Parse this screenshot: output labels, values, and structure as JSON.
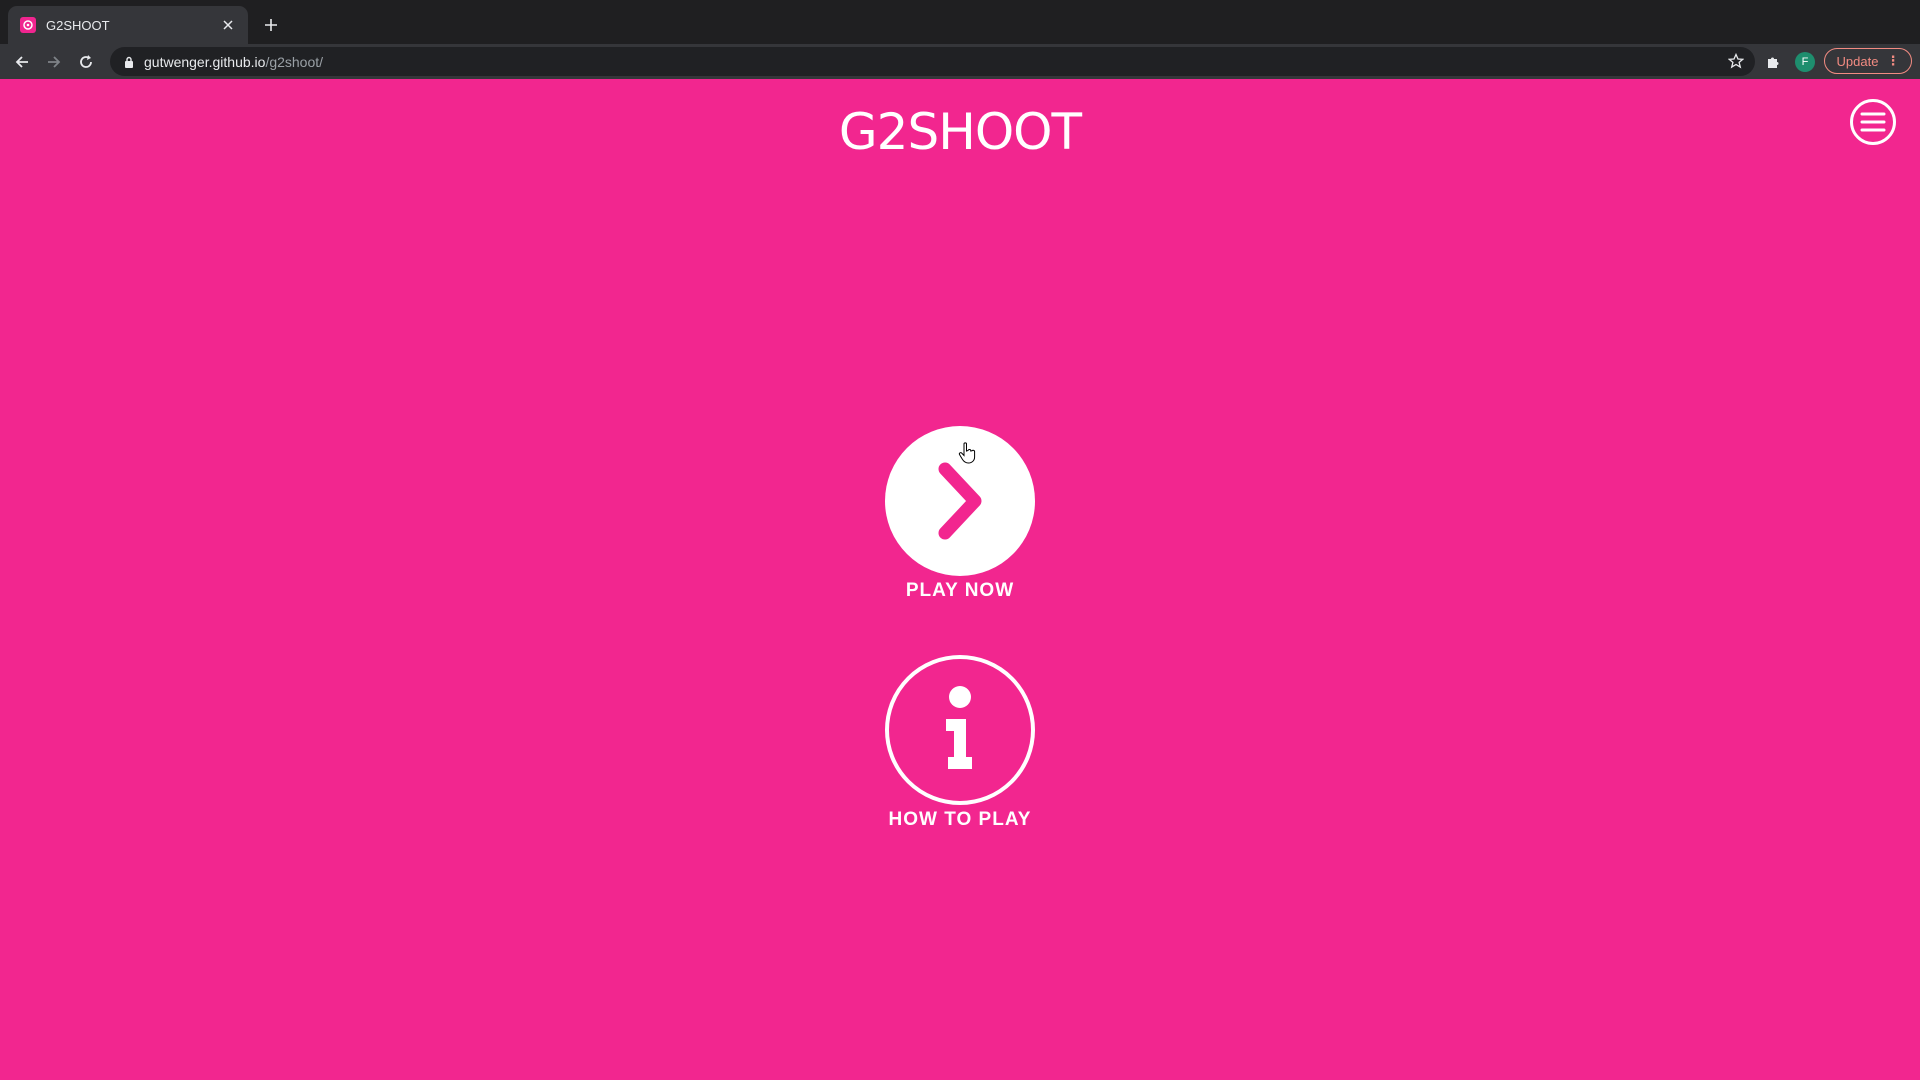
{
  "browser": {
    "tab": {
      "title": "G2SHOOT",
      "favicon": "game-favicon",
      "close": "close-icon"
    },
    "new_tab_icon": "plus-icon",
    "nav": {
      "back": "back-arrow-icon",
      "forward": "forward-arrow-icon",
      "reload": "reload-icon"
    },
    "address": {
      "host": "gutwenger.github.io",
      "path": "/g2shoot/"
    },
    "bookmark_icon": "star-icon",
    "extensions_icon": "puzzle-icon",
    "profile_initial": "F",
    "update_label": "Update",
    "update_menu": "⋮"
  },
  "page": {
    "title": "G2SHOOT",
    "menu_icon": "hamburger-icon",
    "play": {
      "icon": "chevron-right-icon",
      "label": "PLAY NOW"
    },
    "howto": {
      "icon": "info-icon",
      "label": "HOW TO PLAY"
    },
    "colors": {
      "background": "#f2268f",
      "foreground": "#ffffff"
    }
  }
}
